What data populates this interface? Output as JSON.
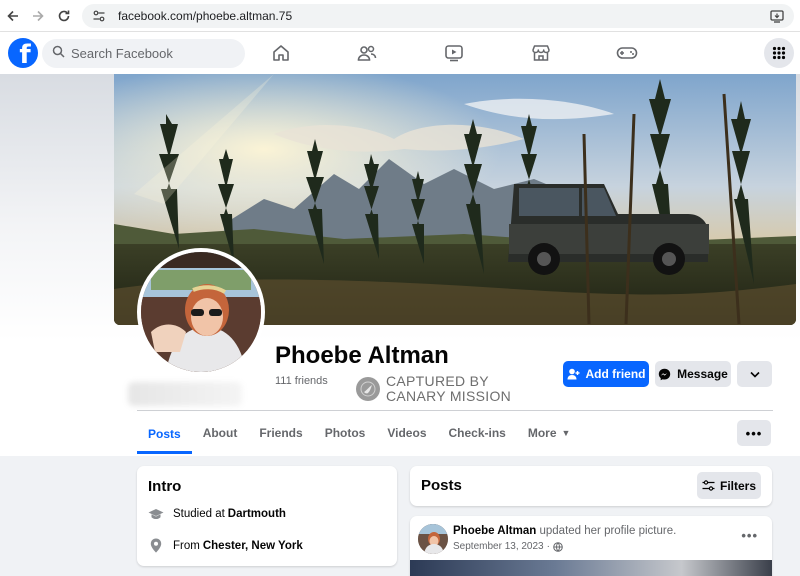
{
  "browser": {
    "url": "facebook.com/phoebe.altman.75"
  },
  "header": {
    "search_placeholder": "Search Facebook",
    "brand_color": "#0866ff"
  },
  "profile": {
    "name": "Phoebe Altman",
    "friends": "111 friends",
    "watermark_line1": "CAPTURED BY",
    "watermark_line2": "CANARY MISSION",
    "add_friend_label": "Add friend",
    "message_label": "Message"
  },
  "tabs": [
    {
      "label": "Posts",
      "active": true
    },
    {
      "label": "About"
    },
    {
      "label": "Friends"
    },
    {
      "label": "Photos"
    },
    {
      "label": "Videos"
    },
    {
      "label": "Check-ins"
    },
    {
      "label": "More"
    }
  ],
  "intro": {
    "title": "Intro",
    "education_prefix": "Studied at",
    "education_school": "Dartmouth",
    "location_prefix": "From",
    "location_place": "Chester, New York"
  },
  "posts": {
    "title": "Posts",
    "filters_label": "Filters"
  },
  "post": {
    "author": "Phoebe Altman",
    "action": "updated her profile picture.",
    "date": "September 13, 2023",
    "date_sep": "·"
  },
  "icons": {
    "back": "arrow-left-icon",
    "forward": "arrow-right-icon",
    "reload": "reload-icon",
    "home": "home-icon",
    "friends": "friends-icon",
    "watch": "video-icon",
    "marketplace": "marketplace-icon",
    "gaming": "gaming-icon",
    "menu": "grid-menu-icon"
  }
}
